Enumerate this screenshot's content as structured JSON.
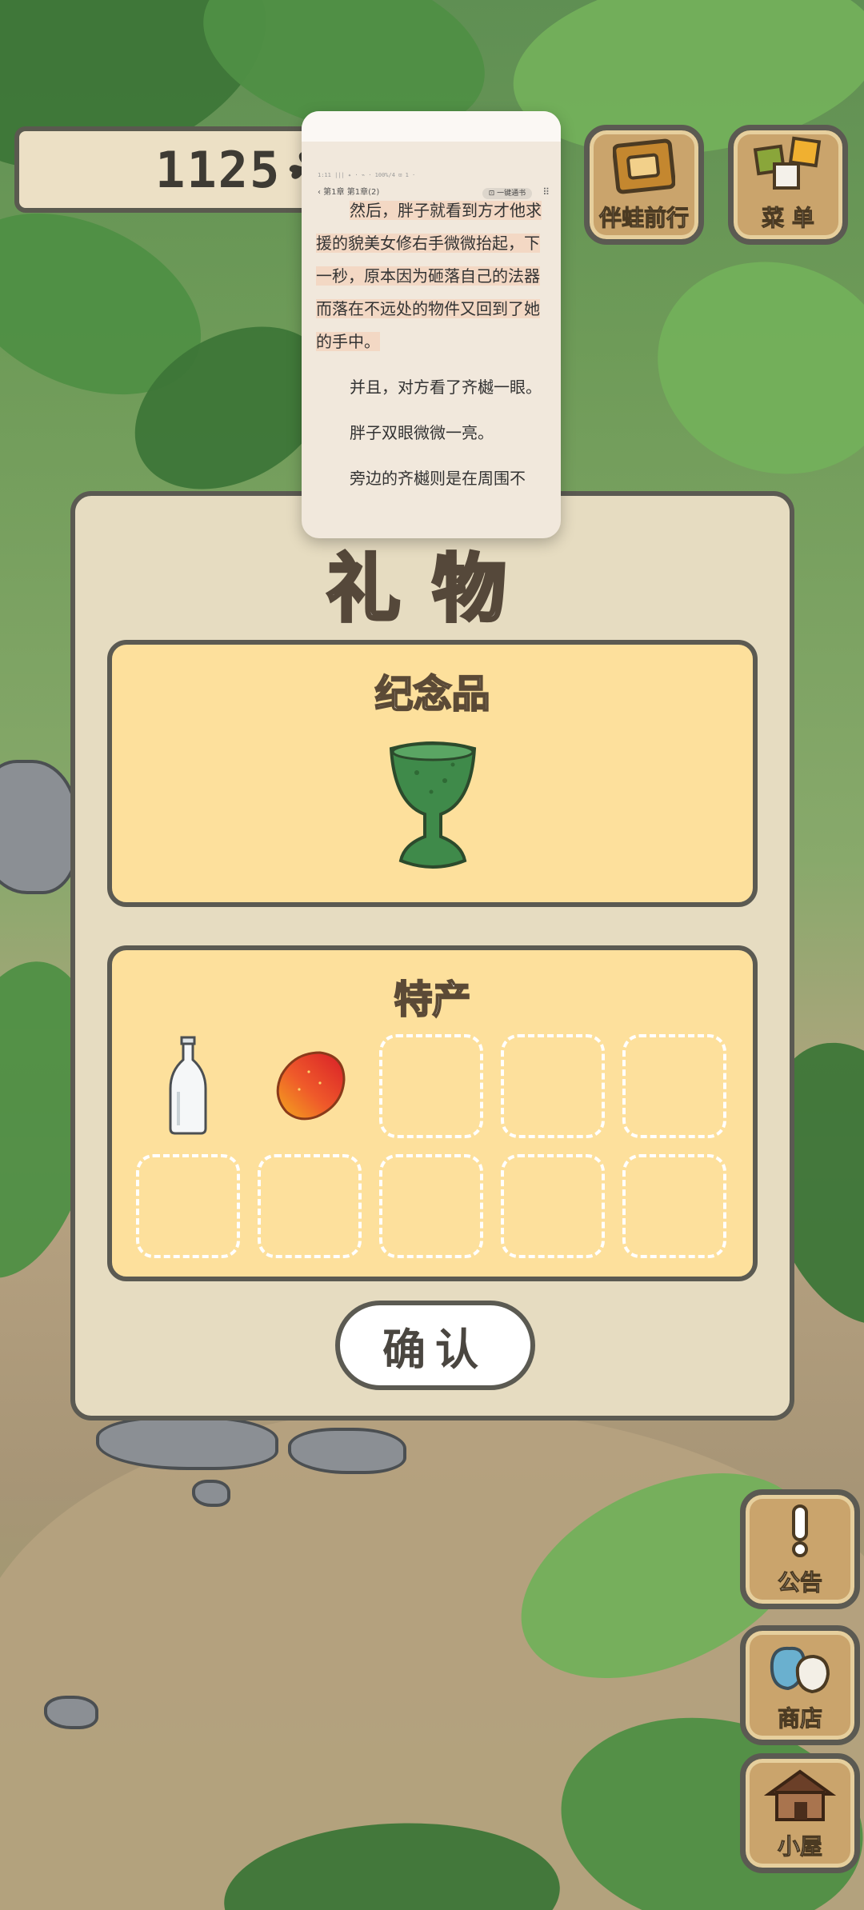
{
  "hud": {
    "clover_count": "1125",
    "clover_icon": "clover-icon",
    "partner_button_label": "伴蛙前行",
    "menu_button_label": "菜 单"
  },
  "gift_dialog": {
    "title": "礼物",
    "souvenir_title": "纪念品",
    "souvenir_item": "green-goblet",
    "specialty_title": "特产",
    "specialty_items": [
      "glass-bottle",
      "mango"
    ],
    "empty_slots": 8,
    "confirm_label": "确认"
  },
  "side_buttons": {
    "notice_label": "公告",
    "shop_label": "商店",
    "house_label": "小屋"
  },
  "reader": {
    "status_line": "1:11 ||| ✦ · ⌁ · 100%/4 ⊡ 1 ·",
    "chapter": "‹ 第1章 第1章(2)",
    "chip": "⊡ 一键通书",
    "more": "⠿",
    "paragraphs": [
      "然后，胖子就看到方才他求援的貌美女修右手微微抬起，下一秒，原本因为砸落自己的法器而落在不远处的物件又回到了她的手中。",
      "并且，对方看了齐樾一眼。",
      "胖子双眼微微一亮。",
      "旁边的齐樾则是在周围不"
    ]
  }
}
